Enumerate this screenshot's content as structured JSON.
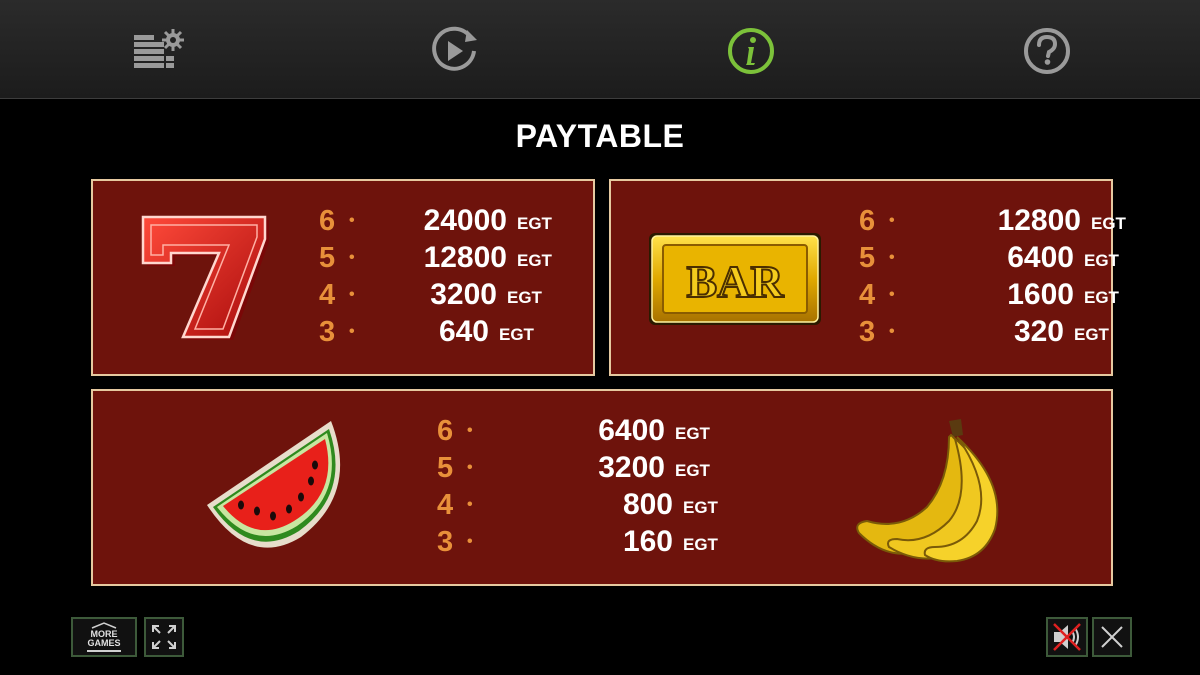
{
  "toolbar": {
    "items": [
      {
        "name": "settings",
        "icon": "bet-settings-icon"
      },
      {
        "name": "autoplay",
        "icon": "autoplay-icon"
      },
      {
        "name": "info",
        "icon": "info-icon",
        "active": true,
        "accent": "#7cc23a"
      },
      {
        "name": "help",
        "icon": "help-icon"
      }
    ]
  },
  "title": "PAYTABLE",
  "colors": {
    "panel": "#6e130c",
    "panel_border": "#e6c9a0",
    "count": "#e8903a",
    "active_accent": "#7cc23a"
  },
  "paytable": {
    "seven": {
      "symbol": "seven-symbol",
      "rows": [
        {
          "count": "6",
          "amount": "24000",
          "currency": "EGT"
        },
        {
          "count": "5",
          "amount": "12800",
          "currency": "EGT"
        },
        {
          "count": "4",
          "amount": "3200",
          "currency": "EGT"
        },
        {
          "count": "3",
          "amount": "640",
          "currency": "EGT"
        }
      ]
    },
    "bar": {
      "symbol": "bar-symbol",
      "label": "BAR",
      "rows": [
        {
          "count": "6",
          "amount": "12800",
          "currency": "EGT"
        },
        {
          "count": "5",
          "amount": "6400",
          "currency": "EGT"
        },
        {
          "count": "4",
          "amount": "1600",
          "currency": "EGT"
        },
        {
          "count": "3",
          "amount": "320",
          "currency": "EGT"
        }
      ]
    },
    "fruits": {
      "symbols": [
        "watermelon-symbol",
        "banana-symbol"
      ],
      "rows": [
        {
          "count": "6",
          "amount": "6400",
          "currency": "EGT"
        },
        {
          "count": "5",
          "amount": "3200",
          "currency": "EGT"
        },
        {
          "count": "4",
          "amount": "800",
          "currency": "EGT"
        },
        {
          "count": "3",
          "amount": "160",
          "currency": "EGT"
        }
      ]
    }
  },
  "bottom": {
    "more_games": {
      "line1": "MORE",
      "line2": "GAMES"
    },
    "fullscreen_icon": "fullscreen-icon",
    "sound_icon": "sound-muted-icon",
    "close_icon": "close-icon"
  }
}
